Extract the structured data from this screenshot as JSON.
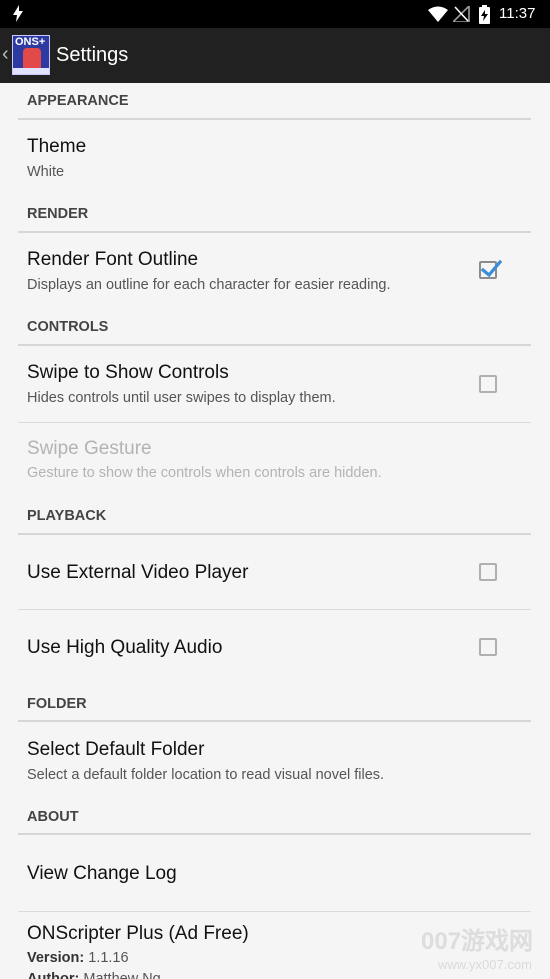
{
  "status_bar": {
    "time": "11:37"
  },
  "app_bar": {
    "title": "Settings",
    "logo_text": "ONS+"
  },
  "sections": {
    "appearance": "APPEARANCE",
    "render": "RENDER",
    "controls": "CONTROLS",
    "playback": "PLAYBACK",
    "folder": "FOLDER",
    "about": "ABOUT"
  },
  "items": {
    "theme": {
      "title": "Theme",
      "summary": "White"
    },
    "render_font_outline": {
      "title": "Render Font Outline",
      "summary": "Displays an outline for each character for easier reading.",
      "checked": true
    },
    "swipe_to_show_controls": {
      "title": "Swipe to Show Controls",
      "summary": "Hides controls until user swipes to display them.",
      "checked": false
    },
    "swipe_gesture": {
      "title": "Swipe Gesture",
      "summary": "Gesture to show the controls when controls are hidden.",
      "enabled": false
    },
    "use_external_video_player": {
      "title": "Use External Video Player",
      "checked": false
    },
    "use_high_quality_audio": {
      "title": "Use High Quality Audio",
      "checked": false
    },
    "select_default_folder": {
      "title": "Select Default Folder",
      "summary": "Select a default folder location to read visual novel files."
    },
    "view_change_log": {
      "title": "View Change Log"
    },
    "app_info": {
      "title": "ONScripter Plus (Ad Free)",
      "version_label": "Version:",
      "version_value": "1.1.16",
      "author_label": "Author:",
      "author_value": "Matthew Ng"
    }
  },
  "watermark": {
    "big": "007游戏网",
    "small": "www.yx007.com"
  },
  "colors": {
    "accent": "#3a8ed6",
    "status_bar": "#000000",
    "app_bar": "#212121",
    "background": "#f5f5f5"
  }
}
